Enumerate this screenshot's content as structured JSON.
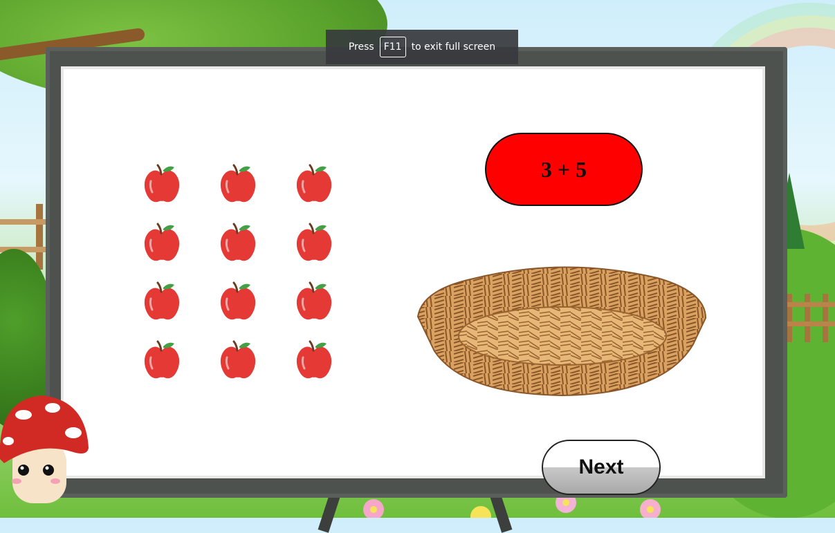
{
  "fullscreen_notice": {
    "prefix": "Press",
    "key": "F11",
    "suffix": "to exit full screen"
  },
  "question": {
    "equation": "3 + 5"
  },
  "apples": {
    "rows": 4,
    "columns": 3,
    "icon": "apple-icon",
    "color": "#e53935"
  },
  "basket": {
    "icon": "basket-icon"
  },
  "navigation": {
    "next_label": "Next"
  },
  "colors": {
    "equation_bg": "#ff0000",
    "board_frame": "#4e524f",
    "board_surface": "#ffffff"
  }
}
